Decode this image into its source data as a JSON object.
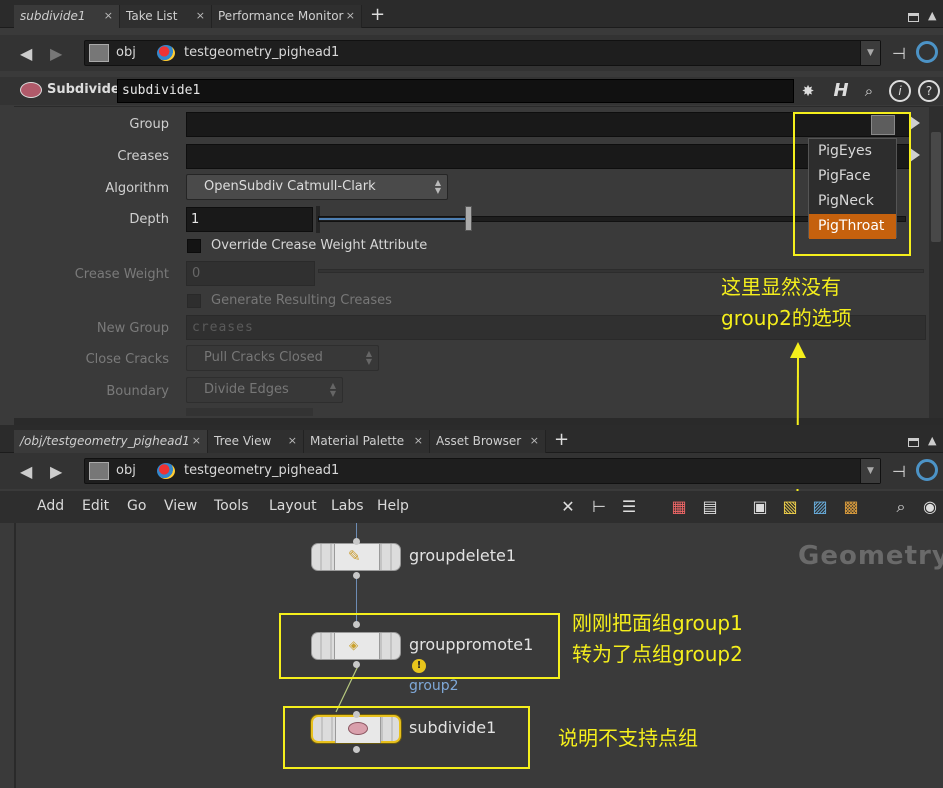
{
  "top_pane": {
    "tabs": [
      {
        "label": "subdivide1",
        "close": "×"
      },
      {
        "label": "Take List",
        "close": "×"
      },
      {
        "label": "Performance Monitor",
        "close": "×"
      }
    ],
    "add_tab": "+",
    "path": {
      "seg1": "obj",
      "seg2": "testgeometry_pighead1",
      "drop": "▼"
    }
  },
  "param_editor": {
    "node_type": "Subdivide",
    "node_name": "subdivide1",
    "labels": {
      "group": "Group",
      "creases": "Creases",
      "algorithm": "Algorithm",
      "depth": "Depth",
      "crease_weight": "Crease Weight",
      "new_group": "New Group",
      "close_cracks": "Close Cracks",
      "boundary": "Boundary"
    },
    "algorithm_value": "OpenSubdiv Catmull-Clark",
    "depth_value": "1",
    "override_crease_label": "Override Crease Weight Attribute",
    "crease_weight_value": "0",
    "generate_creases_label": "Generate Resulting Creases",
    "new_group_placeholder": "creases",
    "close_cracks_value": "Pull Cracks Closed",
    "boundary_value": "Divide Edges",
    "depth_fraction": 0.255
  },
  "group_popup": {
    "items": [
      "PigEyes",
      "PigFace",
      "PigNeck",
      "PigThroat"
    ],
    "selected": "PigThroat"
  },
  "annotations": {
    "top_right": [
      "这里显然没有",
      "group2的选项"
    ],
    "middle": [
      "刚刚把面组group1",
      "转为了点组group2"
    ],
    "bottom": "说明不支持点组"
  },
  "bottom_pane": {
    "tabs": [
      {
        "label": "/obj/testgeometry_pighead1",
        "close": "×"
      },
      {
        "label": "Tree View",
        "close": "×"
      },
      {
        "label": "Material Palette",
        "close": "×"
      },
      {
        "label": "Asset Browser",
        "close": "×"
      }
    ],
    "add_tab": "+",
    "path": {
      "seg1": "obj",
      "seg2": "testgeometry_pighead1",
      "drop": "▼"
    },
    "menu": [
      "Add",
      "Edit",
      "Go",
      "View",
      "Tools",
      "Layout",
      "Labs",
      "Help"
    ]
  },
  "network": {
    "watermark": "Geometry",
    "nodes": [
      {
        "name": "groupdelete1"
      },
      {
        "name": "grouppromote1",
        "output_label": "group2"
      },
      {
        "name": "subdivide1"
      }
    ]
  },
  "colors": {
    "annotation": "#f5ef1c",
    "selected_item": "#c5610d",
    "wire": "#6d8cb4"
  }
}
